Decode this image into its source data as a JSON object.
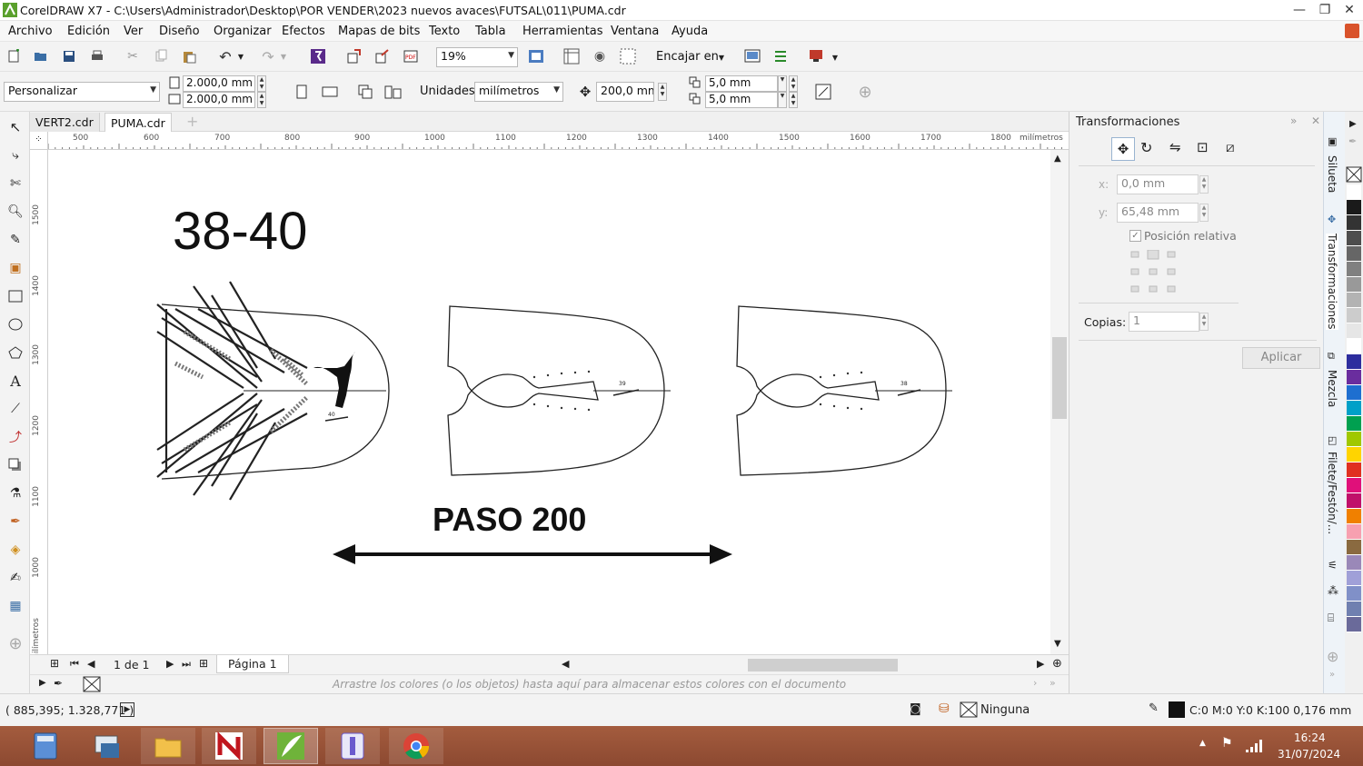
{
  "window": {
    "title": "CorelDRAW X7 - C:\\Users\\Administrador\\Desktop\\POR VENDER\\2023 nuevos avaces\\FUTSAL\\011\\PUMA.cdr"
  },
  "menu": [
    "Archivo",
    "Edición",
    "Ver",
    "Diseño",
    "Organizar",
    "Efectos",
    "Mapas de bits",
    "Texto",
    "Tabla",
    "Herramientas",
    "Ventana",
    "Ayuda"
  ],
  "toolbar1": {
    "zoom": "19%",
    "snap_label": "Encajar en"
  },
  "toolbar2": {
    "preset": "Personalizar",
    "width": "2.000,0 mm",
    "height": "2.000,0 mm",
    "units_label": "Unidades:",
    "units_value": "milímetros",
    "nudge": "200,0 mm",
    "dup_x": "5,0 mm",
    "dup_y": "5,0 mm"
  },
  "tabs": [
    "VERT2.cdr",
    "PUMA.cdr"
  ],
  "ruler": {
    "h_ticks": [
      "500",
      "600",
      "700",
      "800",
      "900",
      "1000",
      "1100",
      "1200",
      "1300",
      "1400",
      "1500",
      "1600",
      "1700",
      "1800"
    ],
    "h_unit": "milímetros",
    "v_ticks": [
      "1500",
      "1400",
      "1300",
      "1200",
      "1100",
      "1000"
    ],
    "v_unit": "milímetros"
  },
  "canvas": {
    "size_label": "38-40",
    "step_label": "PASO 200",
    "small_label_1": "40",
    "small_label_2": "39",
    "small_label_3": "38"
  },
  "pager": {
    "pages": "1 de 1",
    "page_tab": "Página 1"
  },
  "colorstrip": {
    "hint": "Arrastre los colores (o los objetos) hasta aquí para almacenar estos colores con el documento"
  },
  "docker": {
    "title": "Transformaciones",
    "x_label": "x:",
    "x_value": "0,0 mm",
    "y_label": "y:",
    "y_value": "65,48 mm",
    "relative_label": "Posición relativa",
    "copies_label": "Copias:",
    "copies_value": "1",
    "apply_label": "Aplicar"
  },
  "docker_tabs": [
    "Silueta",
    "Transformaciones",
    "Mezcla",
    "Filete/Festón/..."
  ],
  "palette_colors": [
    "#ffffff",
    "#1a1a1a",
    "#333333",
    "#4d4d4d",
    "#666666",
    "#808080",
    "#999999",
    "#b3b3b3",
    "#cccccc",
    "#e6e6e6",
    "#ffffff",
    "#2d2d9e",
    "#6a2d9e",
    "#1e6fd0",
    "#00a0c8",
    "#00a050",
    "#a0c800",
    "#ffd400",
    "#e03020",
    "#e0107a",
    "#c0106a",
    "#f08000",
    "#f7a0b0",
    "#8a6a40",
    "#9a88b8",
    "#a0a0d8",
    "#8090c8",
    "#7080b0",
    "#6a6a9a",
    "#5a5a8a"
  ],
  "status": {
    "coords": "( 885,395; 1.328,771 )",
    "fill_label": "Ninguna",
    "outline_label": "C:0 M:0 Y:0 K:100  0,176 mm"
  },
  "taskbar": {
    "time": "16:24",
    "date": "31/07/2024"
  }
}
